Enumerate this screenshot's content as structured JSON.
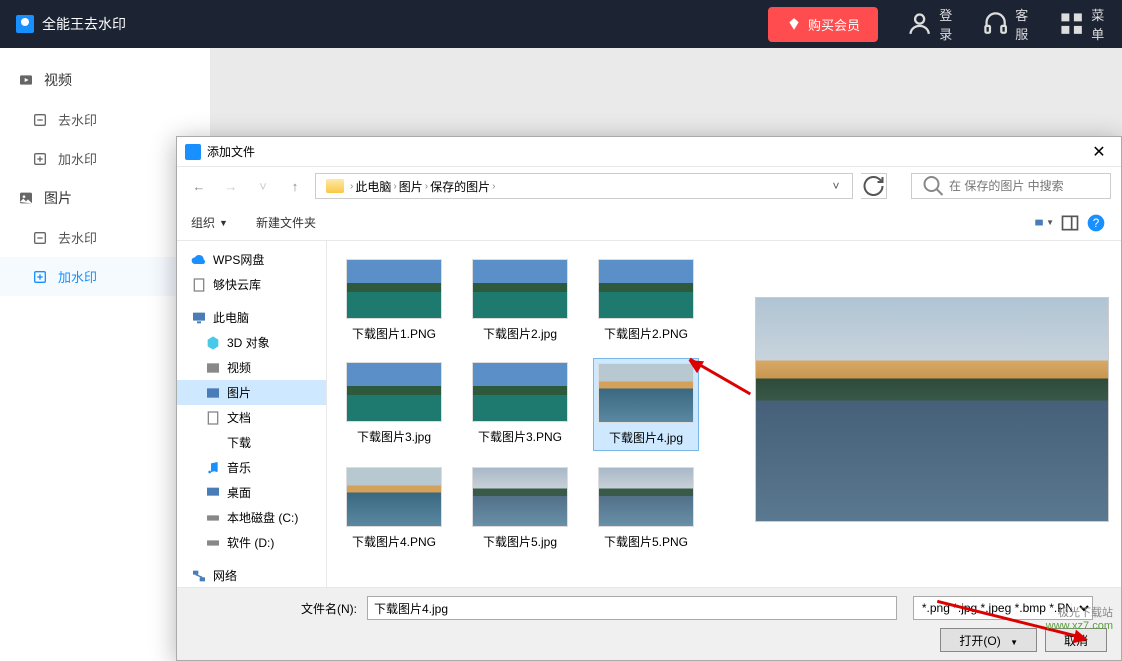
{
  "app": {
    "title": "全能王去水印"
  },
  "topbar": {
    "buy": "购买会员",
    "login": "登录",
    "service": "客服",
    "menu": "菜单"
  },
  "sidebar": {
    "cat_video": "视频",
    "cat_image": "图片",
    "remove_wm": "去水印",
    "add_wm": "加水印",
    "remove_wm2": "去水印",
    "add_wm2": "加水印"
  },
  "dialog": {
    "title": "添加文件",
    "breadcrumb": {
      "p1": "此电脑",
      "p2": "图片",
      "p3": "保存的图片"
    },
    "search_placeholder": "在 保存的图片 中搜索",
    "organize": "组织",
    "new_folder": "新建文件夹",
    "tree": {
      "wps": "WPS网盘",
      "quick": "够快云库",
      "pc": "此电脑",
      "d3d": "3D 对象",
      "video": "视频",
      "pictures": "图片",
      "docs": "文档",
      "download": "下载",
      "music": "音乐",
      "desktop": "桌面",
      "disk_c": "本地磁盘 (C:)",
      "disk_d": "软件 (D:)",
      "network": "网络"
    },
    "files": [
      {
        "name": "下载图片1.PNG",
        "kind": "mtn"
      },
      {
        "name": "下载图片2.jpg",
        "kind": "mtn"
      },
      {
        "name": "下载图片2.PNG",
        "kind": "mtn"
      },
      {
        "name": "下载图片3.jpg",
        "kind": "mtn"
      },
      {
        "name": "下载图片3.PNG",
        "kind": "mtn"
      },
      {
        "name": "下载图片4.jpg",
        "kind": "lake",
        "selected": true
      },
      {
        "name": "下载图片4.PNG",
        "kind": "lake"
      },
      {
        "name": "下载图片5.jpg",
        "kind": "lake2"
      },
      {
        "name": "下载图片5.PNG",
        "kind": "lake2"
      }
    ],
    "footer": {
      "fn_label": "文件名(N):",
      "fn_value": "下载图片4.jpg",
      "filter": "*.png *.jpg *.jpeg *.bmp *.PNG",
      "open": "打开(O)",
      "cancel": "取消"
    }
  },
  "watermark": {
    "line1": "极光下载站",
    "line2": "www.xz7.com"
  }
}
